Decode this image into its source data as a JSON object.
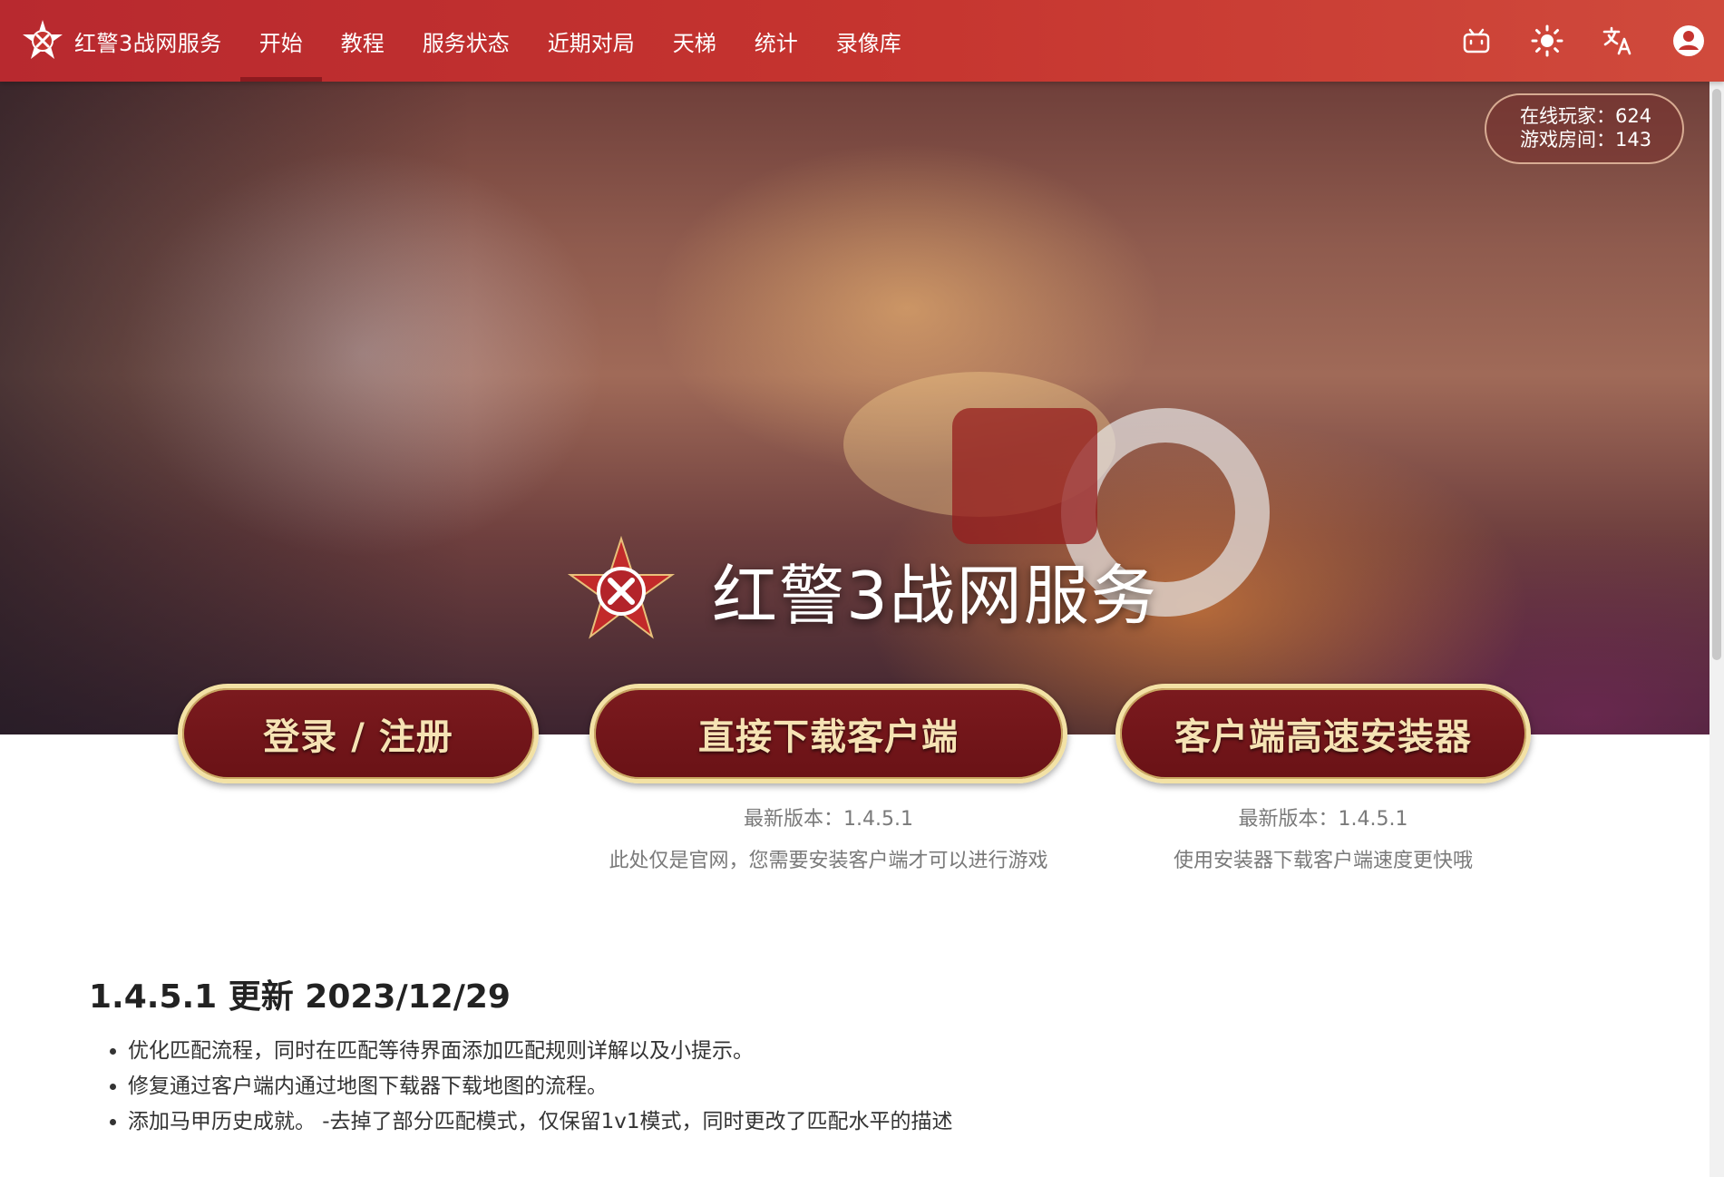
{
  "app": {
    "brand_title": "红警3战网服务"
  },
  "nav": {
    "items": [
      {
        "label": "开始",
        "active": true
      },
      {
        "label": "教程",
        "active": false
      },
      {
        "label": "服务状态",
        "active": false
      },
      {
        "label": "近期对局",
        "active": false
      },
      {
        "label": "天梯",
        "active": false
      },
      {
        "label": "统计",
        "active": false
      },
      {
        "label": "录像库",
        "active": false
      }
    ],
    "right_icons": [
      "bilibili-icon",
      "brightness-icon",
      "translate-icon",
      "account-icon"
    ]
  },
  "hero": {
    "title": "红警3战网服务",
    "online_players": "在线玩家：624",
    "game_rooms": "游戏房间：143"
  },
  "actions": {
    "login": "登录 / 注册",
    "download": "直接下载客户端",
    "installer": "客户端高速安装器",
    "download_version": "最新版本：1.4.5.1",
    "download_note": "此处仅是官网，您需要安装客户端才可以进行游戏",
    "installer_version": "最新版本：1.4.5.1",
    "installer_note": "使用安装器下载客户端速度更快哦"
  },
  "changelog": {
    "title": "1.4.5.1 更新 2023/12/29",
    "items": [
      "优化匹配流程，同时在匹配等待界面添加匹配规则详解以及小提示。",
      "修复通过客户端内通过地图下载器下载地图的流程。",
      "添加马甲历史成就。 -去掉了部分匹配模式，仅保留1v1模式，同时更改了匹配水平的描述"
    ]
  },
  "colors": {
    "topbar": "#c5342f",
    "button_bg": "#7b1a1e",
    "button_border": "#f3e2a5",
    "button_text": "#f6e3b4"
  }
}
